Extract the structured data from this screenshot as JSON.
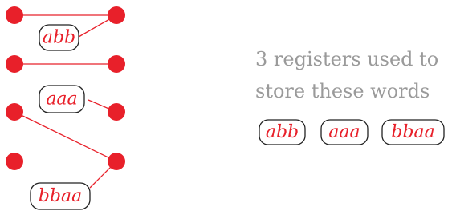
{
  "caption": {
    "line1": "3 registers used to",
    "line2": "store these words"
  },
  "words_on_wires": [
    "abb",
    "aaa",
    "bbaa"
  ],
  "stored_words": [
    "abb",
    "aaa",
    "bbaa"
  ],
  "colors": {
    "accent": "#e8202a",
    "label_border": "#222222",
    "caption_text": "#9a9a9a"
  }
}
